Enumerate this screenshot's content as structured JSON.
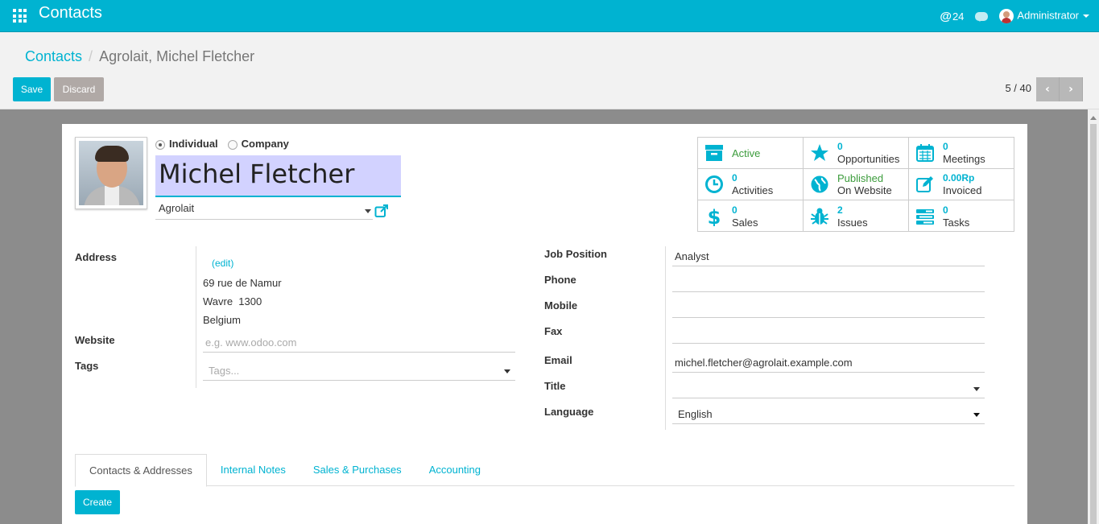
{
  "app": {
    "title": "Contacts"
  },
  "topbar": {
    "mentions": "24",
    "user": "Administrator"
  },
  "breadcrumb": {
    "root": "Contacts",
    "current": "Agrolait, Michel Fletcher"
  },
  "buttons": {
    "save": "Save",
    "discard": "Discard",
    "create": "Create"
  },
  "pager": {
    "value": "5 / 40"
  },
  "partner": {
    "type_options": [
      "Individual",
      "Company"
    ],
    "type_selected": "Individual",
    "name": "Michel Fletcher",
    "company": "Agrolait"
  },
  "stats": [
    {
      "icon": "archive-icon",
      "value": "",
      "label": "Active",
      "label_color": "green"
    },
    {
      "icon": "star-icon",
      "value": "0",
      "label": "Opportunities"
    },
    {
      "icon": "calendar-icon",
      "value": "0",
      "label": "Meetings"
    },
    {
      "icon": "clock-icon",
      "value": "0",
      "label": "Activities"
    },
    {
      "icon": "globe-icon",
      "value": "Published",
      "label": "On Website"
    },
    {
      "icon": "edit-icon",
      "value": "0.00Rp",
      "label": "Invoiced"
    },
    {
      "icon": "dollar-icon",
      "value": "0",
      "label": "Sales"
    },
    {
      "icon": "bug-icon",
      "value": "2",
      "label": "Issues"
    },
    {
      "icon": "tasks-icon",
      "value": "0",
      "label": "Tasks"
    }
  ],
  "left": {
    "address_label": "Address",
    "address_edit": "(edit)",
    "street": "69 rue de Namur",
    "city_zip": "Wavre  1300",
    "country": "Belgium",
    "website_label": "Website",
    "website_placeholder": "e.g. www.odoo.com",
    "tags_label": "Tags",
    "tags_placeholder": "Tags..."
  },
  "right": {
    "job_label": "Job Position",
    "job": "Analyst",
    "phone_label": "Phone",
    "phone": "",
    "mobile_label": "Mobile",
    "mobile": "",
    "fax_label": "Fax",
    "fax": "",
    "email_label": "Email",
    "email": "michel.fletcher@agrolait.example.com",
    "title_label": "Title",
    "title": "",
    "language_label": "Language",
    "language": "English"
  },
  "tabs": [
    "Contacts & Addresses",
    "Internal Notes",
    "Sales & Purchases",
    "Accounting"
  ],
  "colors": {
    "accent": "#00b3d1",
    "muted": "#b0a9a6",
    "green": "#3c9c3c"
  }
}
